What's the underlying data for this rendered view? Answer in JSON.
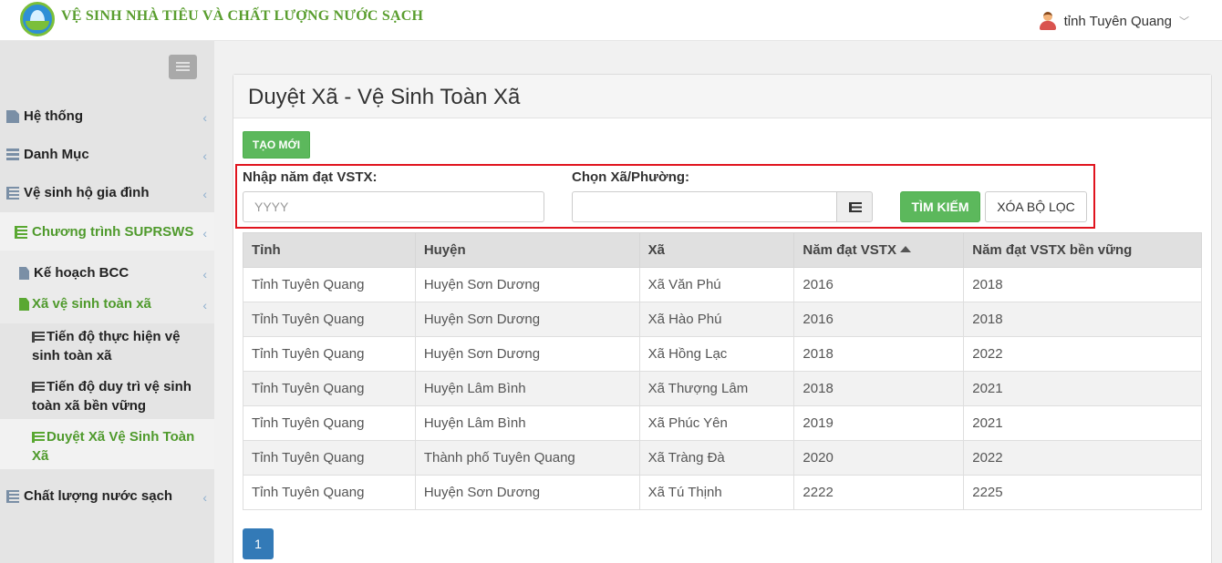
{
  "header": {
    "brand": "VỆ SINH NHÀ TIÊU VÀ CHẤT LƯỢNG NƯỚC SẠCH",
    "user_name": "tỉnh Tuyên Quang",
    "user_chevron": "﹀"
  },
  "sidebar": {
    "items": [
      {
        "label": "Hệ thống",
        "caret": "‹"
      },
      {
        "label": "Danh Mục",
        "caret": "‹"
      },
      {
        "label": "Vệ sinh hộ gia đình",
        "caret": "‹"
      },
      {
        "label": "Chương trình SUPRSWS",
        "caret": "‹"
      },
      {
        "label": "Kế hoạch BCC",
        "caret": "‹"
      },
      {
        "label": "Xã vệ sinh toàn xã",
        "caret": "‹"
      },
      {
        "label": "Tiến độ thực hiện vệ sinh toàn xã"
      },
      {
        "label": "Tiến độ duy trì vệ sinh toàn xã bền vững"
      },
      {
        "label": "Duyệt Xã Vệ Sinh Toàn Xã"
      },
      {
        "label": "Chất lượng nước sạch",
        "caret": "‹"
      }
    ]
  },
  "main": {
    "title": "Duyệt Xã - Vệ Sinh Toàn Xã",
    "new_button": "TẠO MỚI",
    "filters": {
      "year_label": "Nhập năm đạt VSTX:",
      "year_placeholder": "YYYY",
      "commune_label": "Chọn Xã/Phường:",
      "search_button": "TÌM KIẾM",
      "clear_button": "XÓA BỘ LỌC"
    },
    "table": {
      "headers": [
        "Tỉnh",
        "Huyện",
        "Xã",
        "Năm đạt VSTX",
        "Năm đạt VSTX bền vững"
      ],
      "rows": [
        [
          "Tỉnh Tuyên Quang",
          "Huyện Sơn Dương",
          "Xã Văn Phú",
          "2016",
          "2018"
        ],
        [
          "Tỉnh Tuyên Quang",
          "Huyện Sơn Dương",
          "Xã Hào Phú",
          "2016",
          "2018"
        ],
        [
          "Tỉnh Tuyên Quang",
          "Huyện Sơn Dương",
          "Xã Hồng Lạc",
          "2018",
          "2022"
        ],
        [
          "Tỉnh Tuyên Quang",
          "Huyện Lâm Bình",
          "Xã Thượng Lâm",
          "2018",
          "2021"
        ],
        [
          "Tỉnh Tuyên Quang",
          "Huyện Lâm Bình",
          "Xã Phúc Yên",
          "2019",
          "2021"
        ],
        [
          "Tỉnh Tuyên Quang",
          "Thành phố Tuyên Quang",
          "Xã Tràng Đà",
          "2020",
          "2022"
        ],
        [
          "Tỉnh Tuyên Quang",
          "Huyện Sơn Dương",
          "Xã Tú Thịnh",
          "2222",
          "2225"
        ]
      ]
    },
    "pagination": {
      "current_page": "1"
    }
  }
}
